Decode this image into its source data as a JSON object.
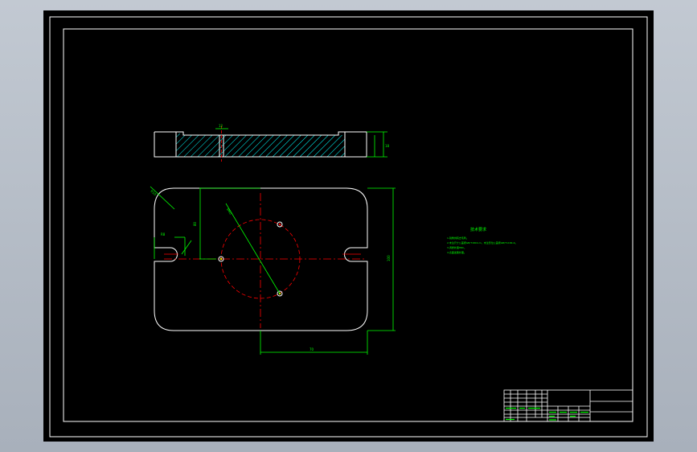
{
  "viewer": {
    "background_color": "#b4bcc6",
    "paper_color": "#000000"
  },
  "colors": {
    "outline": "#ffffff",
    "dimension": "#00ff00",
    "centerline": "#ff0000",
    "hatch": "#00ffff"
  },
  "drawing": {
    "tech_requirements_title": "技术要求",
    "tech_requirements": [
      "1.锐角倒钝去毛刺。",
      "2.未注尺寸公差按GB/T1804-m，未注形位公差按GB/T1184-K。",
      "3.调质处理HRC。",
      "4.表面发黑处理。"
    ],
    "dimensions": {
      "top_slot_width": "12",
      "side_thickness": "18",
      "left_height": "80",
      "slot_radius": "R8",
      "corner_radius": "R10",
      "pcd_diameter": "Ø60",
      "right_height": "100",
      "bottom_length": "70"
    }
  }
}
